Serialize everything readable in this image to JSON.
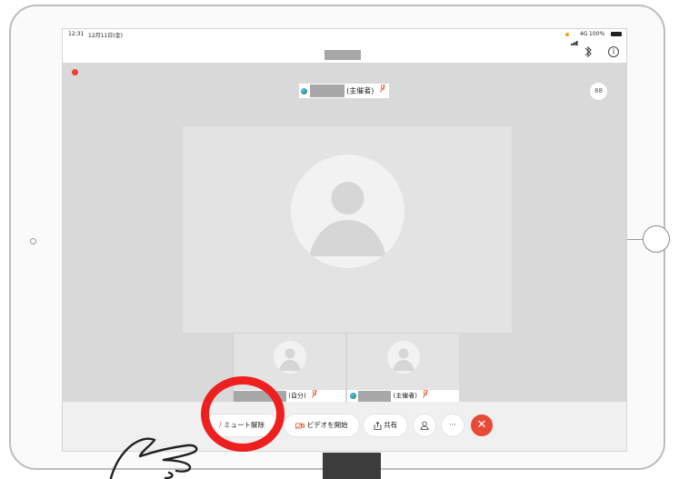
{
  "status_bar": {
    "time": "12:31",
    "date": "12月11日(金)",
    "network": "4G",
    "battery": "100%"
  },
  "meeting": {
    "icons": {
      "bluetooth": "bluetooth-icon",
      "info": "info-icon",
      "layout": "grid-layout-icon",
      "muted_mic": "mic-muted-icon",
      "webex_logo": "webex-logo-icon"
    },
    "host_label": "(主催者)",
    "host_mic_icon": "̸",
    "grid_glyph": "88",
    "info_glyph": "i"
  },
  "thumbnails": [
    {
      "label": "(自分)"
    },
    {
      "label": "(主催者)"
    }
  ],
  "toolbar": {
    "unmute_label": "ミュート解除",
    "start_video_label": "ビデオを開始",
    "share_label": "共有",
    "more_label": "···",
    "end_label": "✕"
  },
  "colors": {
    "meeting_bg": "#d9d9d9",
    "end_button": "#e84a34",
    "highlight_circle": "#ee1f1f",
    "muted_icon": "#e94e2a"
  }
}
